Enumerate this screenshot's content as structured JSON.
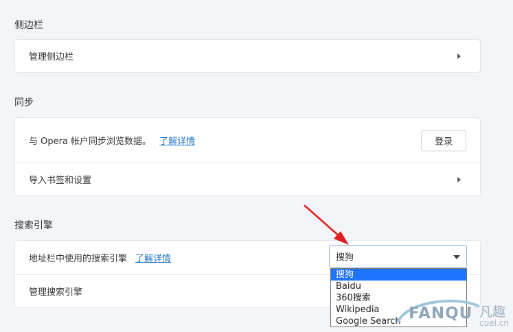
{
  "sidebar_section": {
    "title": "侧边栏",
    "manage_label": "管理侧边栏"
  },
  "sync_section": {
    "title": "同步",
    "sync_text": "与 Opera 帐户同步浏览数据。",
    "learn_more": "了解详情",
    "login_label": "登录",
    "import_label": "导入书签和设置"
  },
  "search_section": {
    "title": "搜索引擎",
    "address_bar_label": "地址栏中使用的搜索引擎",
    "learn_more": "了解详情",
    "selected_engine": "搜狗",
    "manage_label": "管理搜索引擎",
    "options": [
      "搜狗",
      "Baidu",
      "360搜索",
      "Wikipedia",
      "Google Search"
    ]
  },
  "watermark": {
    "text": "FANQU",
    "cn": "凡趣",
    "domain": "cuel.cn"
  },
  "colors": {
    "accent": "#1f74c7",
    "selected_option": "#1e74ff",
    "arrow": "#e02020"
  }
}
